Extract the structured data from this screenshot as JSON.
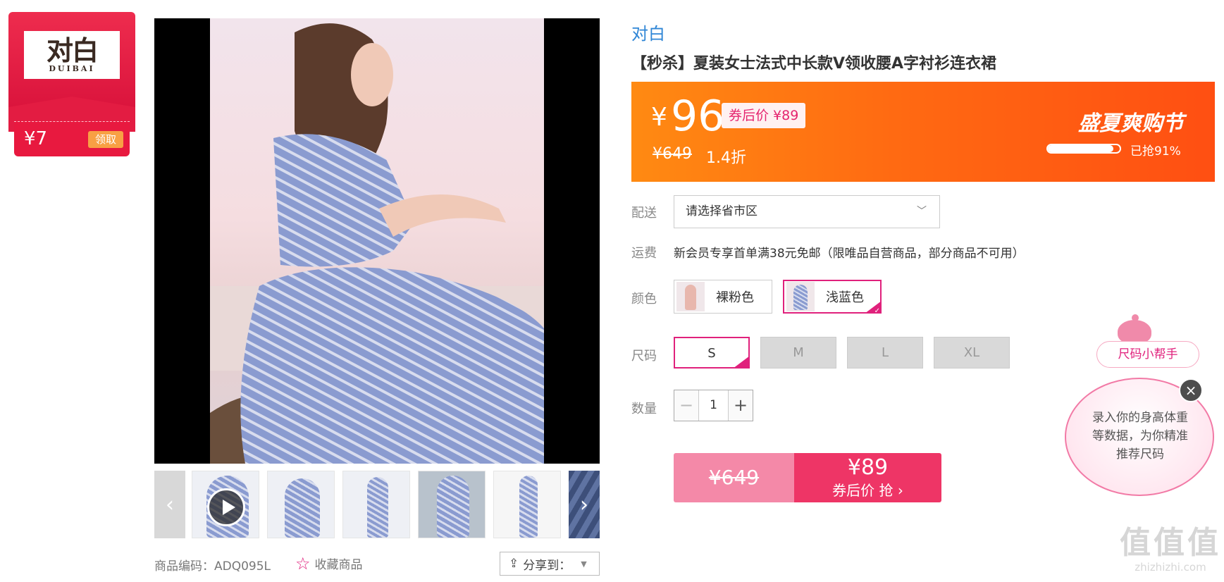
{
  "coupon": {
    "logo_cn": "对白",
    "logo_en": "DUIBAI",
    "amount": "¥7",
    "claim_label": "领取"
  },
  "gallery": {
    "prev_icon": "chevron-left-icon",
    "next_icon": "chevron-right-icon",
    "play_icon": "play-icon"
  },
  "meta": {
    "sku": "商品编码：ADQ095L",
    "favorite_label": "收藏商品",
    "share_label": "分享到："
  },
  "product": {
    "brand": "对白",
    "title": "【秒杀】夏装女士法式中长款V领收腰A字衬衫连衣裙"
  },
  "promo": {
    "currency": "¥",
    "price": "96",
    "coupon_price": "券后价 ¥89",
    "original_price": "¥649",
    "discount": "1.4折",
    "festival": "盛夏爽购节",
    "sold_fraction": 0.91,
    "sold_text": "已抢91%"
  },
  "delivery": {
    "label": "配送",
    "placeholder": "请选择省市区"
  },
  "shipping": {
    "label": "运费",
    "text": "新会员专享首单满38元免邮（限唯品自营商品，部分商品不可用）"
  },
  "colors": {
    "label": "颜色",
    "options": [
      {
        "label": "裸粉色",
        "selected": false
      },
      {
        "label": "浅蓝色",
        "selected": true
      }
    ]
  },
  "sizes": {
    "label": "尺码",
    "options": [
      {
        "label": "S",
        "selected": true
      },
      {
        "label": "M",
        "selected": false
      },
      {
        "label": "L",
        "selected": false
      },
      {
        "label": "XL",
        "selected": false
      }
    ]
  },
  "quantity": {
    "label": "数量",
    "value": "1",
    "minus": "−",
    "plus": "+"
  },
  "buy": {
    "original_price": "¥649",
    "price": "¥89",
    "label": "券后价 抢 ›"
  },
  "size_helper": {
    "tag": "尺码小帮手",
    "text": "录入你的身高体重等数据，为你精准推荐尺码",
    "close": "×"
  },
  "watermark": {
    "big": "值值值",
    "small": "zhizhizhi.com"
  },
  "theme": {
    "accent": "#e0217c",
    "brand_blue": "#2f86d6",
    "promo_orange": "#ff6a12"
  }
}
